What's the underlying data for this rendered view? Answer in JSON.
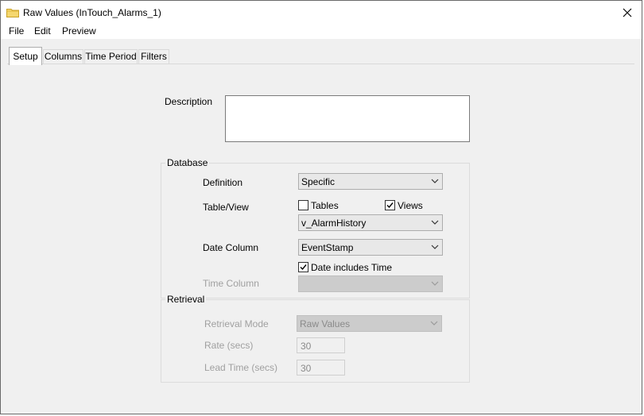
{
  "window": {
    "title": "Raw Values (InTouch_Alarms_1)",
    "close_glyph": "✕"
  },
  "menu": {
    "items": [
      "File",
      "Edit",
      "Preview"
    ]
  },
  "tabs": {
    "items": [
      "Setup",
      "Columns",
      "Time Period",
      "Filters"
    ],
    "active": "Setup"
  },
  "setup": {
    "description_label": "Description",
    "description_value": "",
    "database_group": "Database",
    "definition_label": "Definition",
    "definition_value": "Specific",
    "table_view_label": "Table/View",
    "tables_label": "Tables",
    "tables_checked": false,
    "views_label": "Views",
    "views_checked": true,
    "table_view_value": "v_AlarmHistory",
    "date_column_label": "Date Column",
    "date_column_value": "EventStamp",
    "date_includes_time_label": "Date includes Time",
    "date_includes_time_checked": true,
    "time_column_label": "Time Column",
    "time_column_value": "",
    "retrieval_group": "Retrieval",
    "retrieval_mode_label": "Retrieval Mode",
    "retrieval_mode_value": "Raw Values",
    "rate_label": "Rate (secs)",
    "rate_value": "30",
    "lead_time_label": "Lead Time (secs)",
    "lead_time_value": "30"
  },
  "colors": {
    "window_bg": "#f0f0f0",
    "titlebar_bg": "#ffffff",
    "disabled_text": "#a0a0a0"
  },
  "icons": {
    "title": "folder-icon",
    "close": "close-icon",
    "combo_arrow": "chevron-down-icon",
    "check": "check-icon"
  }
}
